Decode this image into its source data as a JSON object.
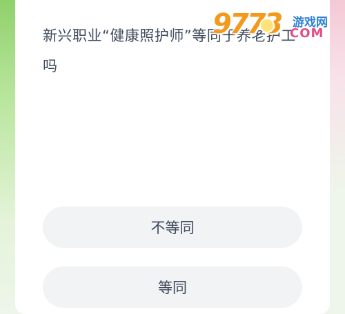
{
  "question": {
    "text": "新兴职业“健康照护师”等同于养老护工吗"
  },
  "options": [
    {
      "label": "不等同"
    },
    {
      "label": "等同"
    }
  ],
  "watermark": {
    "digits": "9773",
    "site_cn": "游戏网",
    "domain": "COM"
  },
  "colors": {
    "text": "#3e4a5c",
    "option_bg": "#f2f3f5",
    "card_bg": "#ffffff",
    "bg_green": "#b9e39a",
    "logo_orange": "#f39a1c"
  }
}
